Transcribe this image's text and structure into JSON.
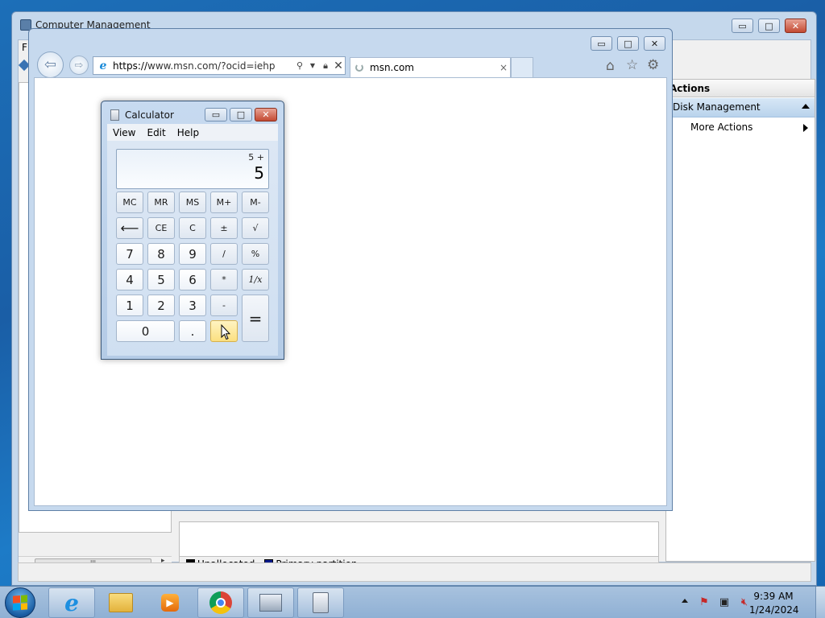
{
  "computer_management": {
    "title": "Computer Management",
    "menu_letter": "F",
    "actions_header": "Actions",
    "actions_section": "Disk Management",
    "more_actions": "More Actions",
    "legend": [
      {
        "label": "Unallocated",
        "color": "#000000"
      },
      {
        "label": "Primary partition",
        "color": "#0a1a8a"
      }
    ],
    "scroll_thumb_grip": "III"
  },
  "browser": {
    "url_scheme": "https://",
    "url_rest": "www.msn.com/?ocid=iehp",
    "tab_title": "msn.com",
    "tab_close": "×",
    "icons": [
      "back-icon",
      "forward-icon",
      "search-icon",
      "lock-icon",
      "stop-icon",
      "home-icon",
      "favorites-icon",
      "tools-icon"
    ]
  },
  "calculator": {
    "title": "Calculator",
    "menu": [
      "View",
      "Edit",
      "Help"
    ],
    "expression": "5  +",
    "value": "5",
    "buttons": {
      "mc": "MC",
      "mr": "MR",
      "ms": "MS",
      "mplus": "M+",
      "mminus": "M-",
      "backspace": "⟵",
      "ce": "CE",
      "c": "C",
      "plusminus": "±",
      "sqrt": "√",
      "n7": "7",
      "n8": "8",
      "n9": "9",
      "divide": "/",
      "percent": "%",
      "n4": "4",
      "n5": "5",
      "n6": "6",
      "multiply": "*",
      "reciprocal": "1/x",
      "n1": "1",
      "n2": "2",
      "n3": "3",
      "subtract": "-",
      "equals": "=",
      "n0": "0",
      "decimal": ".",
      "add": "+"
    },
    "hovered_button": "add"
  },
  "taskbar": {
    "pinned": [
      "Internet Explorer",
      "Windows Explorer",
      "Windows Media Player",
      "Google Chrome",
      "Computer Management",
      "Calculator"
    ],
    "tray_icons": [
      "action-center-icon",
      "network-icon",
      "volume-muted-icon"
    ],
    "time": "9:39 AM",
    "date": "1/24/2024"
  },
  "window_buttons": {
    "minimize": "▭",
    "maximize": "□",
    "close": "✕"
  }
}
